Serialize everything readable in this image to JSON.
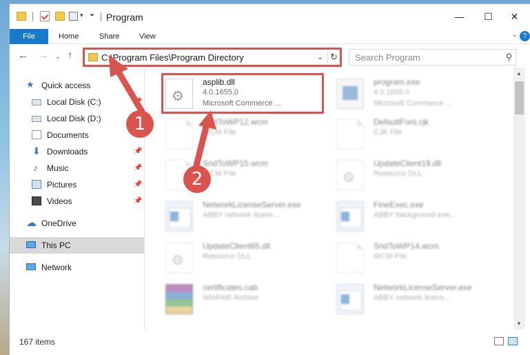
{
  "window": {
    "title": "Program",
    "controls": {
      "minimize": "—",
      "maximize": "☐",
      "close": "✕"
    }
  },
  "ribbon": {
    "tabs": [
      "File",
      "Home",
      "Share",
      "View"
    ]
  },
  "address": {
    "path": "C:\\Program Files\\Program Directory"
  },
  "search": {
    "placeholder": "Search Program"
  },
  "sidebar": {
    "items": [
      {
        "label": "Quick access",
        "icon": "star-icon"
      },
      {
        "label": "Local Disk (C:)",
        "icon": "drive-icon"
      },
      {
        "label": "Local Disk (D:)",
        "icon": "drive-icon"
      },
      {
        "label": "Documents",
        "icon": "documents-icon"
      },
      {
        "label": "Downloads",
        "icon": "download-arrow-icon"
      },
      {
        "label": "Music",
        "icon": "music-note-icon"
      },
      {
        "label": "Pictures",
        "icon": "pictures-icon"
      },
      {
        "label": "Videos",
        "icon": "film-icon"
      },
      {
        "label": "OneDrive",
        "icon": "cloud-icon"
      },
      {
        "label": "This PC",
        "icon": "monitor-icon"
      },
      {
        "label": "Network",
        "icon": "network-icon"
      }
    ]
  },
  "files": [
    {
      "name": "asplib.dll",
      "line2": "4.0.1655.0",
      "line3": "Microsoft Commerce ...",
      "kind": "gear"
    },
    {
      "name": "program.exe",
      "line2": "4.0.1655.0",
      "line3": "Microsoft Commerce ...",
      "kind": "exe"
    },
    {
      "name": "SndToWP12.wcm",
      "line2": "WCM File",
      "line3": "",
      "kind": "doc"
    },
    {
      "name": "DefaultFont.cjk",
      "line2": "CJK File",
      "line3": "",
      "kind": "doc"
    },
    {
      "name": "SndToWP15.wcm",
      "line2": "WCM File",
      "line3": "",
      "kind": "doc"
    },
    {
      "name": "UpdateClient19.dll",
      "line2": "Resource DLL",
      "line3": "",
      "kind": "gear"
    },
    {
      "name": "NetworkLicenseServer.exe",
      "line2": "ABBY network licens...",
      "line3": "",
      "kind": "app"
    },
    {
      "name": "FineExec.exe",
      "line2": "ABBY background exe...",
      "line3": "",
      "kind": "app"
    },
    {
      "name": "UpdateClient65.dll",
      "line2": "Resource DLL",
      "line3": "",
      "kind": "gear"
    },
    {
      "name": "SndToWP14.wcm",
      "line2": "WCM File",
      "line3": "",
      "kind": "doc"
    },
    {
      "name": "certificates.cab",
      "line2": "WinRAR Archive",
      "line3": "",
      "kind": "rar"
    },
    {
      "name": "NetworkLicenseServer.exe",
      "line2": "ABBY network licens...",
      "line3": "",
      "kind": "app"
    }
  ],
  "status": {
    "item_count": "167 items"
  },
  "annotations": {
    "step1": "1",
    "step2": "2"
  },
  "colors": {
    "accent": "#1979ca",
    "highlight": "#d9534f"
  }
}
